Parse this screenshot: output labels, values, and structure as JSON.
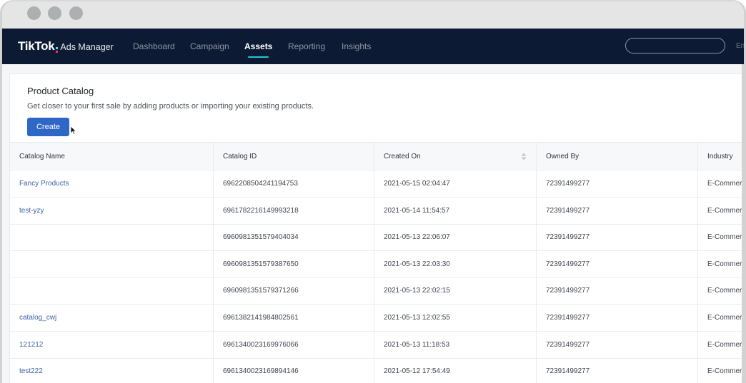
{
  "window": {
    "traffic_lights": [
      "close",
      "minimize",
      "maximize"
    ]
  },
  "navbar": {
    "logo_brand": "TikTok",
    "logo_sub": "Ads Manager",
    "items": [
      {
        "label": "Dashboard",
        "active": false
      },
      {
        "label": "Campaign",
        "active": false
      },
      {
        "label": "Assets",
        "active": true
      },
      {
        "label": "Reporting",
        "active": false
      },
      {
        "label": "Insights",
        "active": false
      }
    ],
    "search_placeholder": "",
    "language": "Eng",
    "active_accent": "#25c5d6",
    "background": "#0c1b33"
  },
  "catalog": {
    "title": "Product Catalog",
    "description": "Get closer to your first sale by adding products or importing your existing products.",
    "create_label": "Create",
    "button_color": "#2f67c7"
  },
  "table": {
    "columns": [
      {
        "label": "Catalog Name",
        "sortable": false
      },
      {
        "label": "Catalog ID",
        "sortable": false
      },
      {
        "label": "Created On",
        "sortable": true
      },
      {
        "label": "Owned By",
        "sortable": false
      },
      {
        "label": "Industry",
        "sortable": false
      }
    ],
    "rows": [
      {
        "name": "Fancy Products",
        "id": "6962208504241194753",
        "created": "2021-05-15 02:04:47",
        "owner": "72391499277",
        "industry": "E-Commerce"
      },
      {
        "name": "test-yzy",
        "id": "6961782216149993218",
        "created": "2021-05-14 11:54:57",
        "owner": "72391499277",
        "industry": "E-Commerce"
      },
      {
        "name": "",
        "id": "6960981351579404034",
        "created": "2021-05-13 22:06:07",
        "owner": "72391499277",
        "industry": "E-Commerce"
      },
      {
        "name": "",
        "id": "6960981351579387650",
        "created": "2021-05-13 22:03:30",
        "owner": "72391499277",
        "industry": "E-Commerce"
      },
      {
        "name": "",
        "id": "6960981351579371266",
        "created": "2021-05-13 22:02:15",
        "owner": "72391499277",
        "industry": "E-Commerce"
      },
      {
        "name": "catalog_cwj",
        "id": "6961382141984802561",
        "created": "2021-05-13 12:02:55",
        "owner": "72391499277",
        "industry": "E-Commerce"
      },
      {
        "name": "121212",
        "id": "6961340023169976066",
        "created": "2021-05-13 11:18:53",
        "owner": "72391499277",
        "industry": "E-Commerce"
      },
      {
        "name": "test222",
        "id": "6961340023169894146",
        "created": "2021-05-12 17:54:49",
        "owner": "72391499277",
        "industry": "E-Commerce"
      }
    ]
  }
}
